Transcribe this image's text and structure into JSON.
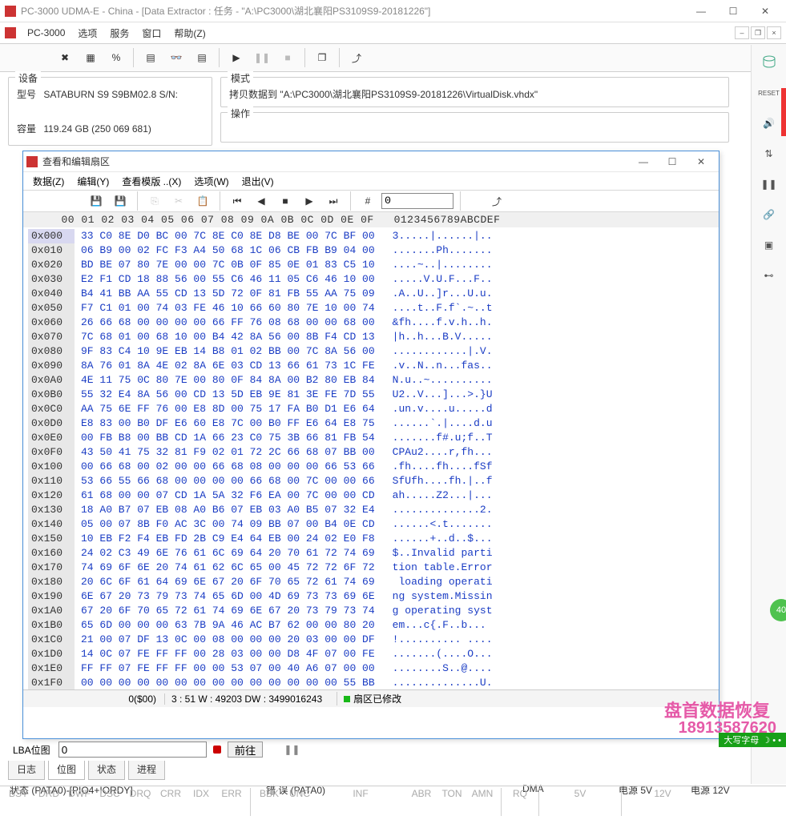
{
  "window": {
    "title": "PC-3000 UDMA-E - China - [Data Extractor : 任务 - \"A:\\PC3000\\湖北襄阳PS3109S9-20181226\"]"
  },
  "menubar": {
    "app": "PC-3000",
    "items": [
      "选项",
      "服务",
      "窗口",
      "帮助(Z)"
    ]
  },
  "device": {
    "legend": "设备",
    "model_label": "型号",
    "model_value": "SATABURN  S9 S9BM02.8 S/N:",
    "capacity_label": "容量",
    "capacity_value": "119.24 GB (250 069 681)"
  },
  "mode": {
    "legend": "模式",
    "copy_text": "拷贝数据到 \"A:\\PC3000\\湖北襄阳PS3109S9-20181226\\VirtualDisk.vhdx\"",
    "operation_label": "操作"
  },
  "sector_editor": {
    "title": "查看和编辑扇区",
    "menu": [
      "数据(Z)",
      "编辑(Y)",
      "查看模版 ..(X)",
      "选项(W)",
      "退出(V)"
    ],
    "offset_input": "0",
    "header": "     00 01 02 03 04 05 06 07 08 09 0A 0B 0C 0D 0E 0F   0123456789ABCDEF",
    "rows": [
      {
        "addr": "0x000",
        "bytes": "33 C0 8E D0 BC 00 7C 8E C0 8E D8 BE 00 7C BF 00",
        "ascii": "3.....|......|.."
      },
      {
        "addr": "0x010",
        "bytes": "06 B9 00 02 FC F3 A4 50 68 1C 06 CB FB B9 04 00",
        "ascii": ".......Ph......."
      },
      {
        "addr": "0x020",
        "bytes": "BD BE 07 80 7E 00 00 7C 0B 0F 85 0E 01 83 C5 10",
        "ascii": "....~..|........"
      },
      {
        "addr": "0x030",
        "bytes": "E2 F1 CD 18 88 56 00 55 C6 46 11 05 C6 46 10 00",
        "ascii": ".....V.U.F...F.."
      },
      {
        "addr": "0x040",
        "bytes": "B4 41 BB AA 55 CD 13 5D 72 0F 81 FB 55 AA 75 09",
        "ascii": ".A..U..]r...U.u."
      },
      {
        "addr": "0x050",
        "bytes": "F7 C1 01 00 74 03 FE 46 10 66 60 80 7E 10 00 74",
        "ascii": "....t..F.f`.~..t"
      },
      {
        "addr": "0x060",
        "bytes": "26 66 68 00 00 00 00 66 FF 76 08 68 00 00 68 00",
        "ascii": "&fh....f.v.h..h."
      },
      {
        "addr": "0x070",
        "bytes": "7C 68 01 00 68 10 00 B4 42 8A 56 00 8B F4 CD 13",
        "ascii": "|h..h...B.V....."
      },
      {
        "addr": "0x080",
        "bytes": "9F 83 C4 10 9E EB 14 B8 01 02 BB 00 7C 8A 56 00",
        "ascii": "............|.V."
      },
      {
        "addr": "0x090",
        "bytes": "8A 76 01 8A 4E 02 8A 6E 03 CD 13 66 61 73 1C FE",
        "ascii": ".v..N..n...fas.."
      },
      {
        "addr": "0x0A0",
        "bytes": "4E 11 75 0C 80 7E 00 80 0F 84 8A 00 B2 80 EB 84",
        "ascii": "N.u..~.........."
      },
      {
        "addr": "0x0B0",
        "bytes": "55 32 E4 8A 56 00 CD 13 5D EB 9E 81 3E FE 7D 55",
        "ascii": "U2..V...]...>.}U"
      },
      {
        "addr": "0x0C0",
        "bytes": "AA 75 6E FF 76 00 E8 8D 00 75 17 FA B0 D1 E6 64",
        "ascii": ".un.v....u.....d"
      },
      {
        "addr": "0x0D0",
        "bytes": "E8 83 00 B0 DF E6 60 E8 7C 00 B0 FF E6 64 E8 75",
        "ascii": "......`.|....d.u"
      },
      {
        "addr": "0x0E0",
        "bytes": "00 FB B8 00 BB CD 1A 66 23 C0 75 3B 66 81 FB 54",
        "ascii": ".......f#.u;f..T"
      },
      {
        "addr": "0x0F0",
        "bytes": "43 50 41 75 32 81 F9 02 01 72 2C 66 68 07 BB 00",
        "ascii": "CPAu2....r,fh..."
      },
      {
        "addr": "0x100",
        "bytes": "00 66 68 00 02 00 00 66 68 08 00 00 00 66 53 66",
        "ascii": ".fh....fh....fSf"
      },
      {
        "addr": "0x110",
        "bytes": "53 66 55 66 68 00 00 00 00 66 68 00 7C 00 00 66",
        "ascii": "SfUfh....fh.|..f"
      },
      {
        "addr": "0x120",
        "bytes": "61 68 00 00 07 CD 1A 5A 32 F6 EA 00 7C 00 00 CD",
        "ascii": "ah.....Z2...|..."
      },
      {
        "addr": "0x130",
        "bytes": "18 A0 B7 07 EB 08 A0 B6 07 EB 03 A0 B5 07 32 E4",
        "ascii": "..............2."
      },
      {
        "addr": "0x140",
        "bytes": "05 00 07 8B F0 AC 3C 00 74 09 BB 07 00 B4 0E CD",
        "ascii": "......<.t......."
      },
      {
        "addr": "0x150",
        "bytes": "10 EB F2 F4 EB FD 2B C9 E4 64 EB 00 24 02 E0 F8",
        "ascii": "......+..d..$..."
      },
      {
        "addr": "0x160",
        "bytes": "24 02 C3 49 6E 76 61 6C 69 64 20 70 61 72 74 69",
        "ascii": "$..Invalid parti"
      },
      {
        "addr": "0x170",
        "bytes": "74 69 6F 6E 20 74 61 62 6C 65 00 45 72 72 6F 72",
        "ascii": "tion table.Error"
      },
      {
        "addr": "0x180",
        "bytes": "20 6C 6F 61 64 69 6E 67 20 6F 70 65 72 61 74 69",
        "ascii": " loading operati"
      },
      {
        "addr": "0x190",
        "bytes": "6E 67 20 73 79 73 74 65 6D 00 4D 69 73 73 69 6E",
        "ascii": "ng system.Missin"
      },
      {
        "addr": "0x1A0",
        "bytes": "67 20 6F 70 65 72 61 74 69 6E 67 20 73 79 73 74",
        "ascii": "g operating syst"
      },
      {
        "addr": "0x1B0",
        "bytes": "65 6D 00 00 00 63 7B 9A 46 AC B7 62 00 00 80 20",
        "ascii": "em...c{.F..b... "
      },
      {
        "addr": "0x1C0",
        "bytes": "21 00 07 DF 13 0C 00 08 00 00 00 20 03 00 00 DF",
        "ascii": "!.......... ...."
      },
      {
        "addr": "0x1D0",
        "bytes": "14 0C 07 FE FF FF 00 28 03 00 00 D8 4F 07 00 FE",
        "ascii": ".......(....O..."
      },
      {
        "addr": "0x1E0",
        "bytes": "FF FF 07 FE FF FF 00 00 53 07 00 40 A6 07 00 00",
        "ascii": "........S..@...."
      },
      {
        "addr": "0x1F0",
        "bytes": "00 00 00 00 00 00 00 00 00 00 00 00 00 00 55 BB",
        "ascii": "..............U."
      }
    ],
    "status": {
      "pos": "0($00)",
      "bw_dw": "3 : 51 W : 49203 DW : 3499016243",
      "modified": "扇区已修改"
    }
  },
  "addr_bar": {
    "label": "LBA位图",
    "value": "0",
    "go": "前往"
  },
  "tabs": [
    "日志",
    "位图",
    "状态",
    "进程"
  ],
  "status_headings": {
    "pata": "状态 (PATA0)-[PIO4+IORDY]",
    "err": "错 误 (PATA0)",
    "dma": "DMA",
    "p5": "电源 5V",
    "p12": "电源 12V"
  },
  "bottom": {
    "pata_labels": [
      "BSY",
      "DRD",
      "DWF",
      "DSC",
      "DRQ",
      "CRR",
      "IDX",
      "ERR"
    ],
    "err_labels": [
      "BBK",
      "UNC",
      "",
      "INF",
      "",
      "ABR",
      "TON",
      "AMN"
    ],
    "dma_labels": [
      "RQ"
    ],
    "pwr5": "5V",
    "pwr12": "12V"
  },
  "caps_badge": "大写字母",
  "watermark1": "盘首数据恢复",
  "watermark2": "18913587620"
}
